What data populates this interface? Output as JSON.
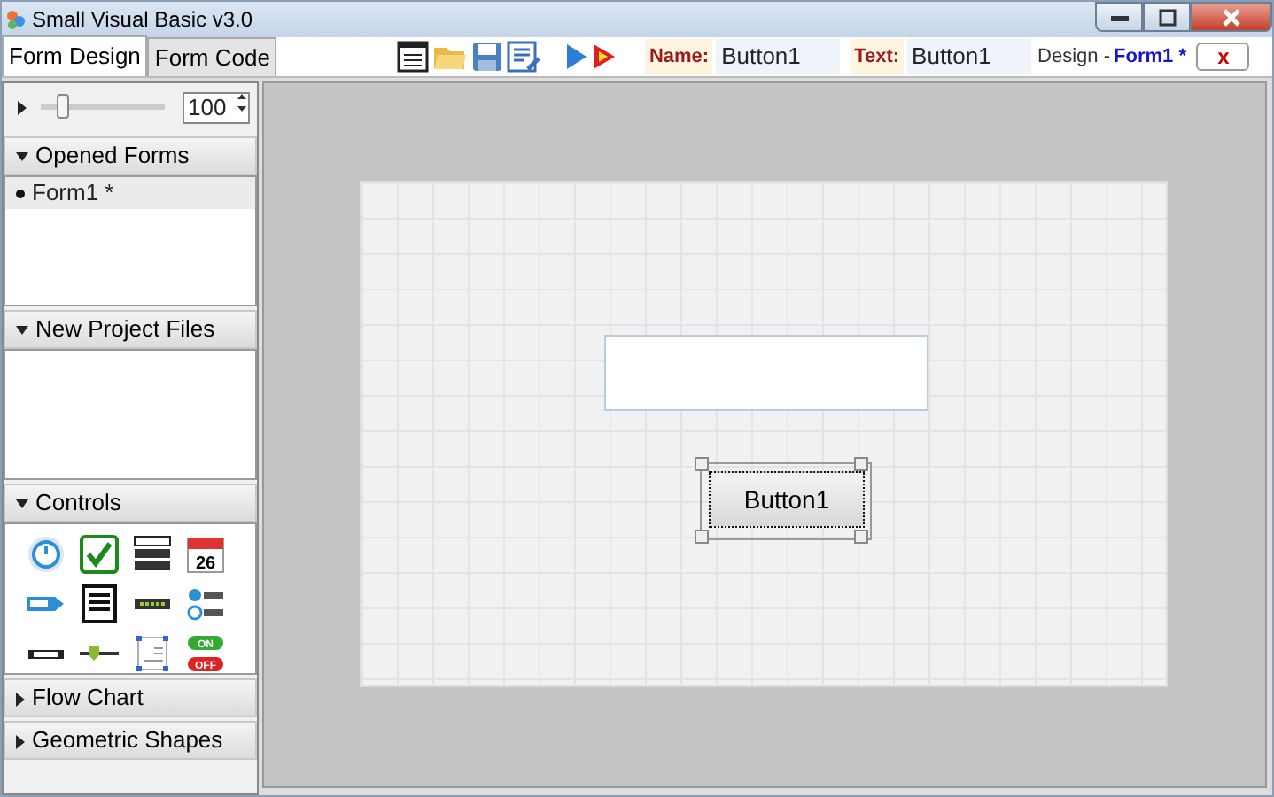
{
  "window": {
    "title": "Small Visual Basic v3.0"
  },
  "tabs": [
    {
      "label": "Form Design",
      "selected": true
    },
    {
      "label": "Form Code",
      "selected": false
    }
  ],
  "toolbar": {
    "name_label": "Name:",
    "name_value": "Button1",
    "text_label": "Text:",
    "text_value": "Button1",
    "design_label": "Design -",
    "design_form": "Form1 *",
    "close_button": "x"
  },
  "zoom": {
    "level": 0.15,
    "value": "100"
  },
  "sections": [
    {
      "title": "Opened Forms",
      "expanded": true,
      "kind": "list",
      "items": [
        {
          "label": "Form1 *",
          "selected": true
        }
      ]
    },
    {
      "title": "New Project Files",
      "expanded": true,
      "kind": "list"
    },
    {
      "title": "Controls",
      "expanded": true,
      "kind": "palette",
      "tools": [
        {
          "kind": "power"
        },
        {
          "kind": "check"
        },
        {
          "kind": "combo"
        },
        {
          "kind": "calendar",
          "text": "26"
        },
        {
          "kind": "label"
        },
        {
          "kind": "list"
        },
        {
          "kind": "textbox"
        },
        {
          "kind": "radio"
        },
        {
          "kind": "scroll"
        },
        {
          "kind": "slider"
        },
        {
          "kind": "image"
        },
        {
          "kind": "toggle",
          "text": "ON",
          "text2": "OFF"
        }
      ]
    },
    {
      "title": "Flow Chart",
      "expanded": false
    },
    {
      "title": "Geometric Shapes",
      "expanded": false
    }
  ],
  "form": {
    "controls": [
      {
        "kind": "textbox"
      },
      {
        "kind": "button",
        "text": "Button1",
        "selected": true
      }
    ]
  }
}
